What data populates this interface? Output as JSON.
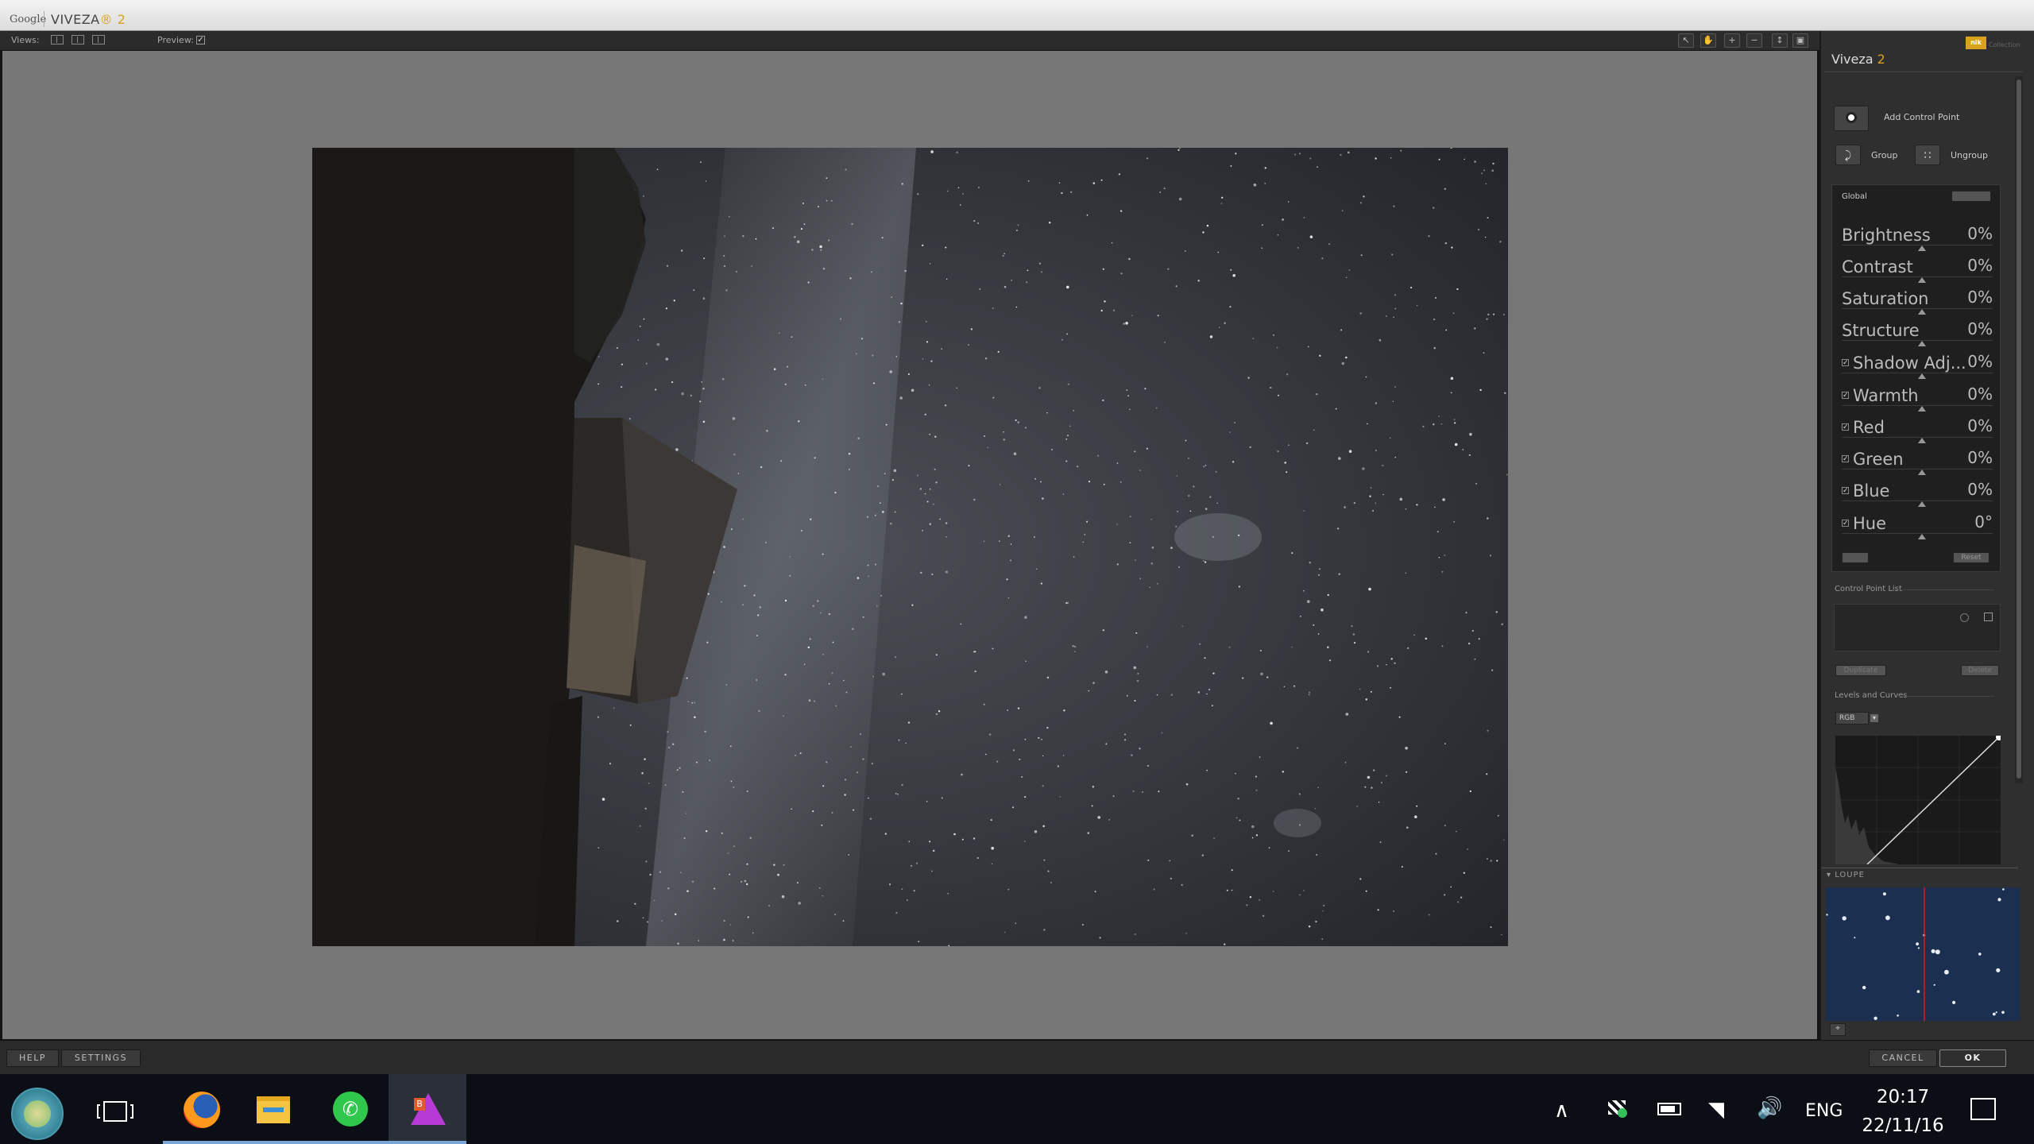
{
  "window": {
    "vendor": "Google",
    "title": "VIVEZA",
    "version_mark": "® 2"
  },
  "toolbar": {
    "views_label": "Views:",
    "preview_label": "Preview:",
    "preview_checked": "✓"
  },
  "panel": {
    "title": "Viveza",
    "title_version": "2",
    "brand_badge": "nik",
    "brand_text": "Collection",
    "add_control_point": "Add Control Point",
    "group": "Group",
    "ungroup": "Ungroup",
    "global_label": "Global",
    "adjustments": [
      {
        "name": "Brightness",
        "value": "0%"
      },
      {
        "name": "Contrast",
        "value": "0%"
      },
      {
        "name": "Saturation",
        "value": "0%"
      },
      {
        "name": "Structure",
        "value": "0%"
      },
      {
        "name": "Shadow Adj...",
        "value": "0%"
      },
      {
        "name": "Warmth",
        "value": "0%"
      },
      {
        "name": "Red",
        "value": "0%"
      },
      {
        "name": "Green",
        "value": "0%"
      },
      {
        "name": "Blue",
        "value": "0%"
      },
      {
        "name": "Hue",
        "value": "0°"
      }
    ],
    "reset": "Reset",
    "control_point_list": "Control Point List",
    "duplicate": "Duplicate",
    "delete": "Delete",
    "levels_and_curves": "Levels and Curves",
    "channel": "RGB",
    "loupe": "LOUPE"
  },
  "bottom": {
    "help": "HELP",
    "settings": "SETTINGS",
    "cancel": "CANCEL",
    "ok": "OK"
  },
  "taskbar": {
    "language": "ENG",
    "time": "20:17",
    "date": "22/11/16"
  },
  "colors": {
    "accent": "#d8a21d",
    "canvas": "#777777",
    "panel": "#2f2f2f"
  }
}
